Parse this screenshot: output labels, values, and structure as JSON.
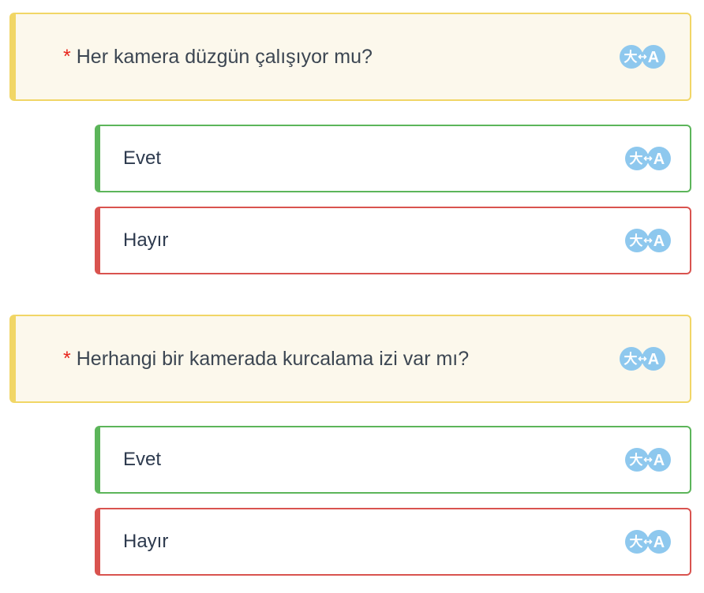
{
  "questions": [
    {
      "required_mark": "*",
      "text": "Her kamera düzgün çalışıyor mu?",
      "translate_icon": "translate-icon",
      "answers": [
        {
          "label": "Evet",
          "status": "positive",
          "color": "#5cb55a"
        },
        {
          "label": "Hayır",
          "status": "negative",
          "color": "#d9534f"
        }
      ]
    },
    {
      "required_mark": "*",
      "text": "Herhangi bir kamerada kurcalama izi var mı?",
      "translate_icon": "translate-icon",
      "answers": [
        {
          "label": "Evet",
          "status": "positive",
          "color": "#5cb55a"
        },
        {
          "label": "Hayır",
          "status": "negative",
          "color": "#d9534f"
        }
      ]
    }
  ],
  "colors": {
    "question_border": "#f1d666",
    "question_bg": "#fcf8ec",
    "required": "#e8251c",
    "translate_icon": "#8ec8ee"
  }
}
